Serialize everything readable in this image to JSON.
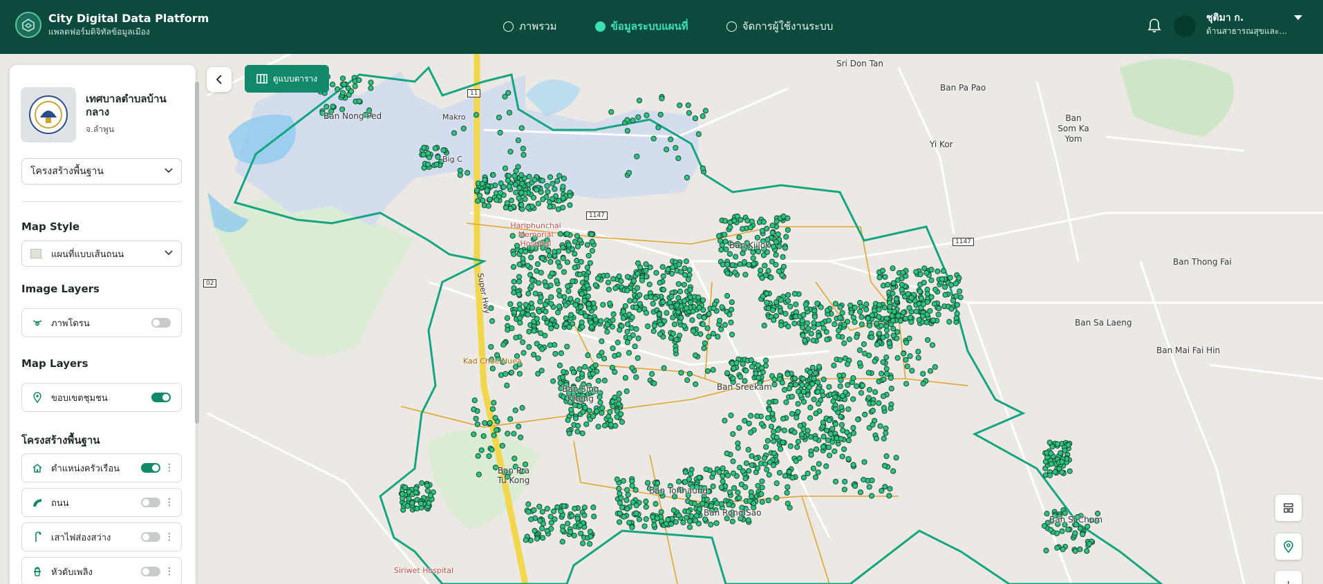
{
  "brand": {
    "title": "City Digital Data Platform",
    "subtitle": "แพลตฟอร์มดิจิทัลข้อมูลเมือง"
  },
  "nav": [
    {
      "label": "ภาพรวม",
      "active": false
    },
    {
      "label": "ข้อมูลระบบแผนที่",
      "active": true
    },
    {
      "label": "จัดการผู้ใช้งานระบบ",
      "active": false
    }
  ],
  "user": {
    "name": "ชุติมา ก.",
    "department": "ด้านสาธารณสุขและ..."
  },
  "sidebar": {
    "org_name": "เทศบาลตำบลบ้านกลาง",
    "org_province": "จ.ลำพูน",
    "category_select": "โครงสร้างพื้นฐาน",
    "map_style_title": "Map Style",
    "map_style_value": "แผนที่แบบเส้นถนน",
    "image_layers_title": "Image Layers",
    "image_layers": [
      {
        "label": "ภาพโดรน",
        "icon": "drone-icon",
        "enabled": false
      }
    ],
    "map_layers_title": "Map Layers",
    "map_layers": [
      {
        "label": "ขอบเขตชุมชน",
        "icon": "location-pin-icon",
        "enabled": true
      }
    ],
    "infra_title": "โครงสร้างพื้นฐาน",
    "infra_layers": [
      {
        "label": "ตำแหน่งครัวเรือน",
        "icon": "house-icon",
        "enabled": true
      },
      {
        "label": "ถนน",
        "icon": "road-icon",
        "enabled": false
      },
      {
        "label": "เสาไฟส่องสว่าง",
        "icon": "street-light-icon",
        "enabled": false
      },
      {
        "label": "หัวดับเพลิง",
        "icon": "fire-hydrant-icon",
        "enabled": false
      }
    ]
  },
  "toolbar": {
    "table_view_label": "ดูแบบตาราง"
  },
  "map": {
    "colors": {
      "boundary": "#12a57f",
      "household_point": "#2ec27e",
      "subdistrict": "#e0a530",
      "highway": "#f2d64b"
    },
    "labels": [
      "Sri Don Tan",
      "Ban Pa Pao",
      "Ban Som Ka Yom",
      "Yi Kor",
      "Ban Nong Ped",
      "Makro",
      "Big C",
      "Hariphunchai Memorial Hospital",
      "Ban Kiilok",
      "Ban Thong Fai",
      "Ban Sa Laeng",
      "Ban Mai Fai Hin",
      "Super Hwy",
      "Kad Chae Nuea",
      "Ban Sing Kheng",
      "Ban Sreekam",
      "Ban Pra Tu Kong",
      "Ban Tonhaung",
      "Ban Rong Sao",
      "Ban Si Chum",
      "Siriwet Hospital",
      "1147",
      "11",
      "1147",
      "02"
    ]
  }
}
